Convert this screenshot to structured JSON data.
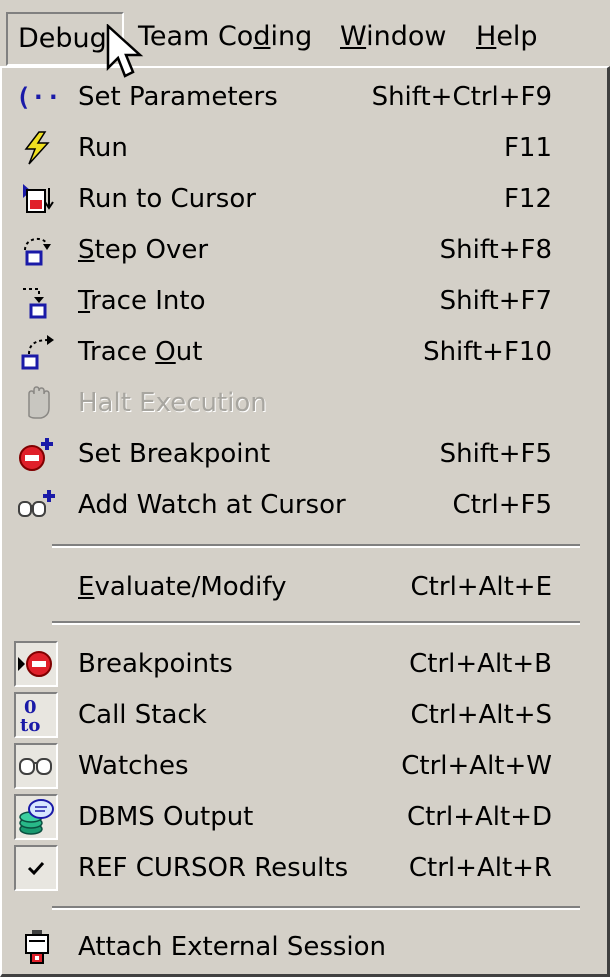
{
  "menubar": {
    "debug": "Debug",
    "team_coding_pre": "Team Co",
    "team_coding_ul": "d",
    "team_coding_post": "ing",
    "window_ul": "W",
    "window_post": "indow",
    "help_ul": "H",
    "help_post": "elp"
  },
  "debug_menu": {
    "items": [
      {
        "label": "Set Parameters",
        "shortcut": "Shift+Ctrl+F9",
        "icon": "parameters-icon"
      },
      {
        "label": "Run",
        "shortcut": "F11",
        "icon": "run-lightning-icon"
      },
      {
        "label": "Run to Cursor",
        "shortcut": "F12",
        "icon": "run-to-cursor-icon"
      },
      {
        "label_ul": "S",
        "label_post": "tep Over",
        "shortcut": "Shift+F8",
        "icon": "step-over-icon"
      },
      {
        "label_ul": "T",
        "label_post": "race Into",
        "shortcut": "Shift+F7",
        "icon": "trace-into-icon"
      },
      {
        "label_pre": "Trace ",
        "label_ul": "O",
        "label_post": "ut",
        "shortcut": "Shift+F10",
        "icon": "trace-out-icon"
      },
      {
        "label": "Halt Execution",
        "shortcut": "",
        "icon": "halt-hand-icon",
        "disabled": true
      },
      {
        "label": "Set Breakpoint",
        "shortcut": "Shift+F5",
        "icon": "set-breakpoint-icon"
      },
      {
        "label": "Add Watch at Cursor",
        "shortcut": "Ctrl+F5",
        "icon": "add-watch-icon"
      },
      {
        "label_ul": "E",
        "label_post": "valuate/Modify",
        "shortcut": "Ctrl+Alt+E"
      },
      {
        "label": "Breakpoints",
        "shortcut": "Ctrl+Alt+B",
        "icon": "breakpoints-icon",
        "checked": true
      },
      {
        "label": "Call Stack",
        "shortcut": "Ctrl+Alt+S",
        "icon": "call-stack-icon",
        "checked": true
      },
      {
        "label": "Watches",
        "shortcut": "Ctrl+Alt+W",
        "icon": "watches-icon",
        "checked": true
      },
      {
        "label": "DBMS Output",
        "shortcut": "Ctrl+Alt+D",
        "icon": "dbms-output-icon",
        "checked": true
      },
      {
        "label": "REF CURSOR Results",
        "shortcut": "Ctrl+Alt+R",
        "icon": "checkmark-icon",
        "checked": true
      },
      {
        "label": "Attach External Session",
        "shortcut": "",
        "icon": "attach-session-icon"
      }
    ]
  },
  "colors": {
    "menu_background": "#d4d0c8",
    "disabled_text": "#a8a6a0",
    "breakpoint_red": "#e0202a",
    "accent_blue": "#1a1aa8"
  }
}
